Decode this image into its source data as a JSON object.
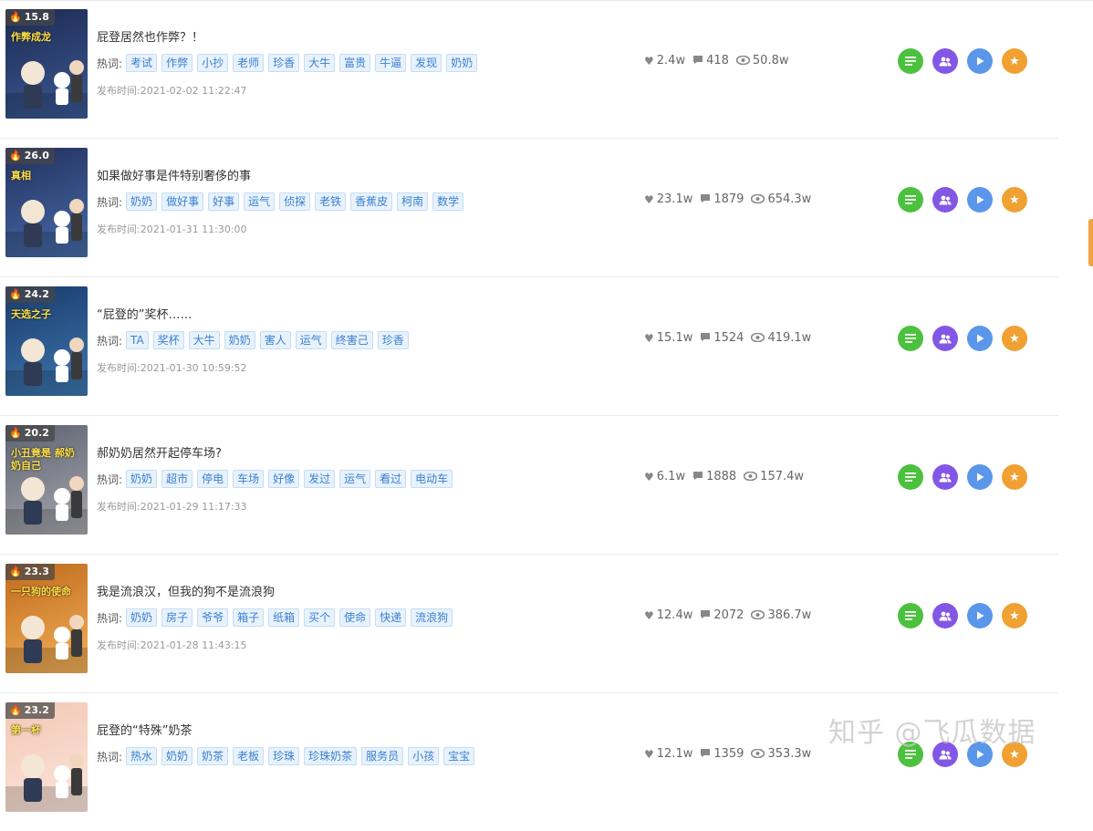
{
  "labels": {
    "hotwords": "热词:",
    "published_prefix": "发布时间:"
  },
  "watermark": "知乎 @飞瓜数据",
  "colors": {
    "tag_bg": "#e8f2fc",
    "tag_text": "#3a80cf",
    "btn_green": "#4cc13f",
    "btn_purple": "#8357e6",
    "btn_blue": "#5a97ea",
    "btn_orange": "#f0a131",
    "side_tab": "#f2a341"
  },
  "actions_icons": [
    "list-icon",
    "users-icon",
    "play-icon",
    "star-icon"
  ],
  "items": [
    {
      "heat": "15.8",
      "thumb_text": "作弊成龙",
      "thumb_colors": [
        "#1d2a52",
        "#3b5a94"
      ],
      "title": "屁登居然也作弊？！",
      "tags": [
        "考试",
        "作弊",
        "小抄",
        "老师",
        "珍香",
        "大牛",
        "富贵",
        "牛逼",
        "发现",
        "奶奶"
      ],
      "date": "2021-02-02 11:22:47",
      "likes": "2.4w",
      "comments": "418",
      "views": "50.8w"
    },
    {
      "heat": "26.0",
      "thumb_text": "真相",
      "thumb_colors": [
        "#22305e",
        "#486ca8"
      ],
      "title": "如果做好事是件特别奢侈的事",
      "tags": [
        "奶奶",
        "做好事",
        "好事",
        "运气",
        "侦探",
        "老铁",
        "香蕉皮",
        "柯南",
        "数学"
      ],
      "date": "2021-01-31 11:30:00",
      "likes": "23.1w",
      "comments": "1879",
      "views": "654.3w"
    },
    {
      "heat": "24.2",
      "thumb_text": "天选之子",
      "thumb_colors": [
        "#1a3a6a",
        "#3e78b0"
      ],
      "title": "“屁登的”奖杯……",
      "tags": [
        "TA",
        "奖杯",
        "大牛",
        "奶奶",
        "害人",
        "运气",
        "终害己",
        "珍香"
      ],
      "date": "2021-01-30 10:59:52",
      "likes": "15.1w",
      "comments": "1524",
      "views": "419.1w"
    },
    {
      "heat": "20.2",
      "thumb_text": "小丑竟是 郝奶奶自己",
      "thumb_colors": [
        "#5c6270",
        "#a8a9ae"
      ],
      "title": "郝奶奶居然开起停车场?",
      "tags": [
        "奶奶",
        "超市",
        "停电",
        "车场",
        "好像",
        "发过",
        "运气",
        "看过",
        "电动车"
      ],
      "date": "2021-01-29 11:17:33",
      "likes": "6.1w",
      "comments": "1888",
      "views": "157.4w"
    },
    {
      "heat": "23.3",
      "thumb_text": "一只狗的使命",
      "thumb_colors": [
        "#c06a1c",
        "#f2b15a"
      ],
      "title": "我是流浪汉，但我的狗不是流浪狗",
      "tags": [
        "奶奶",
        "房子",
        "爷爷",
        "箱子",
        "纸箱",
        "买个",
        "使命",
        "快递",
        "流浪狗"
      ],
      "date": "2021-01-28 11:43:15",
      "likes": "12.4w",
      "comments": "2072",
      "views": "386.7w"
    },
    {
      "heat": "23.2",
      "thumb_text": "第一杯",
      "thumb_colors": [
        "#f3c7b4",
        "#fbe6dc"
      ],
      "title": "屁登的“特殊”奶茶",
      "tags": [
        "热水",
        "奶奶",
        "奶茶",
        "老板",
        "珍珠",
        "珍珠奶茶",
        "服务员",
        "小孩",
        "宝宝"
      ],
      "date": "",
      "likes": "12.1w",
      "comments": "1359",
      "views": "353.3w"
    }
  ]
}
